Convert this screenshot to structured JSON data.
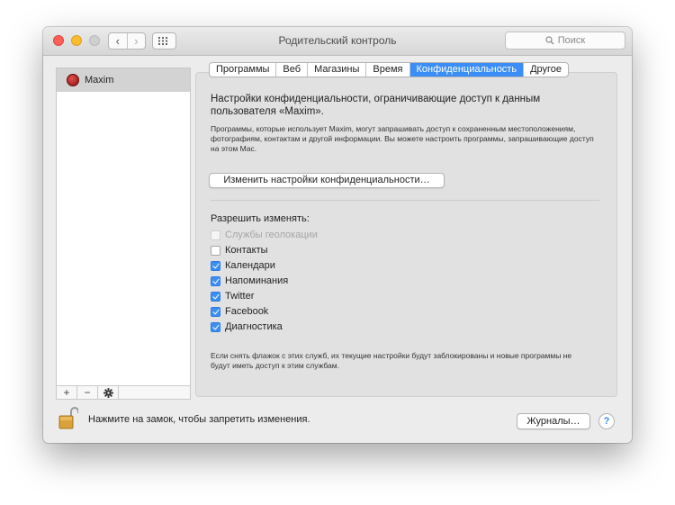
{
  "window": {
    "title": "Родительский контроль",
    "search_placeholder": "Поиск"
  },
  "users": [
    {
      "name": "Maxim"
    }
  ],
  "list_buttons": {
    "add": "+",
    "remove": "−"
  },
  "tabs": [
    {
      "label": "Программы",
      "active": false
    },
    {
      "label": "Веб",
      "active": false
    },
    {
      "label": "Магазины",
      "active": false
    },
    {
      "label": "Время",
      "active": false
    },
    {
      "label": "Конфиденциальность",
      "active": true
    },
    {
      "label": "Другое",
      "active": false
    }
  ],
  "privacy": {
    "heading": "Настройки конфиденциальности, ограничивающие доступ к данным пользователя «Maxim».",
    "description": "Программы, которые использует Maxim, могут запрашивать доступ к сохраненным местоположениям, фотографиям, контактам и другой информации. Вы можете настроить программы, запрашивающие доступ на этом Mac.",
    "change_button": "Изменить настройки конфиденциальности…",
    "allow_label": "Разрешить изменять:",
    "items": [
      {
        "label": "Службы геолокации",
        "checked": false,
        "enabled": false
      },
      {
        "label": "Контакты",
        "checked": false,
        "enabled": true
      },
      {
        "label": "Календари",
        "checked": true,
        "enabled": true
      },
      {
        "label": "Напоминания",
        "checked": true,
        "enabled": true
      },
      {
        "label": "Twitter",
        "checked": true,
        "enabled": true
      },
      {
        "label": "Facebook",
        "checked": true,
        "enabled": true
      },
      {
        "label": "Диагностика",
        "checked": true,
        "enabled": true
      }
    ],
    "footnote": "Если снять флажок с этих служб, их текущие настройки будут заблокированы и новые программы не будут иметь доступ к этим службам."
  },
  "footer": {
    "lock_text": "Нажмите на замок, чтобы запретить изменения.",
    "logs_button": "Журналы…",
    "help": "?"
  },
  "colors": {
    "accent": "#3b8ef5",
    "window_bg": "#ececec",
    "panel_bg": "#e1e1e1"
  }
}
